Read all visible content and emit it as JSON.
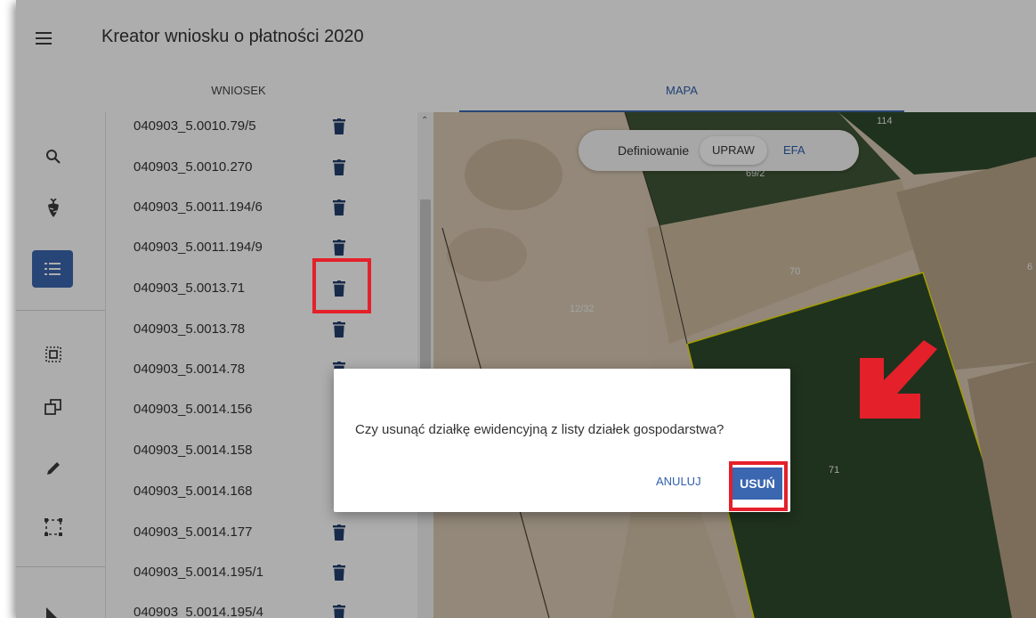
{
  "header": {
    "title": "Kreator wniosku o płatności 2020"
  },
  "tabs": [
    {
      "label": "WNIOSEK"
    },
    {
      "label": "MAPA"
    }
  ],
  "parcels": [
    "040903_5.0010.79/5",
    "040903_5.0010.270",
    "040903_5.0011.194/6",
    "040903_5.0011.194/9",
    "040903_5.0013.71",
    "040903_5.0013.78",
    "040903_5.0014.78",
    "040903_5.0014.156",
    "040903_5.0014.158",
    "040903_5.0014.168",
    "040903_5.0014.177",
    "040903_5.0014.195/1",
    "040903_5.0014.195/4"
  ],
  "map": {
    "toggle_label": "Definiowanie",
    "toggle_upraw": "UPRAW",
    "toggle_efa": "EFA",
    "labels": [
      "114",
      "69/2",
      "70",
      "12/32",
      "71",
      "6"
    ]
  },
  "dialog": {
    "message": "Czy usunąć działkę ewidencyjną z listy działek gospodarstwa?",
    "cancel": "ANULUJ",
    "confirm": "USUŃ"
  },
  "icons": [
    "menu-icon",
    "search-icon",
    "plant-icon",
    "list-icon",
    "select-area-icon",
    "copy-icon",
    "pencil-icon",
    "bounding-box-icon",
    "measure-icon",
    "trash-icon",
    "chevron-up-icon"
  ],
  "colors": {
    "accent": "#3b66b0",
    "highlight": "#e4202a",
    "parcel_outline": "#f2e600"
  }
}
